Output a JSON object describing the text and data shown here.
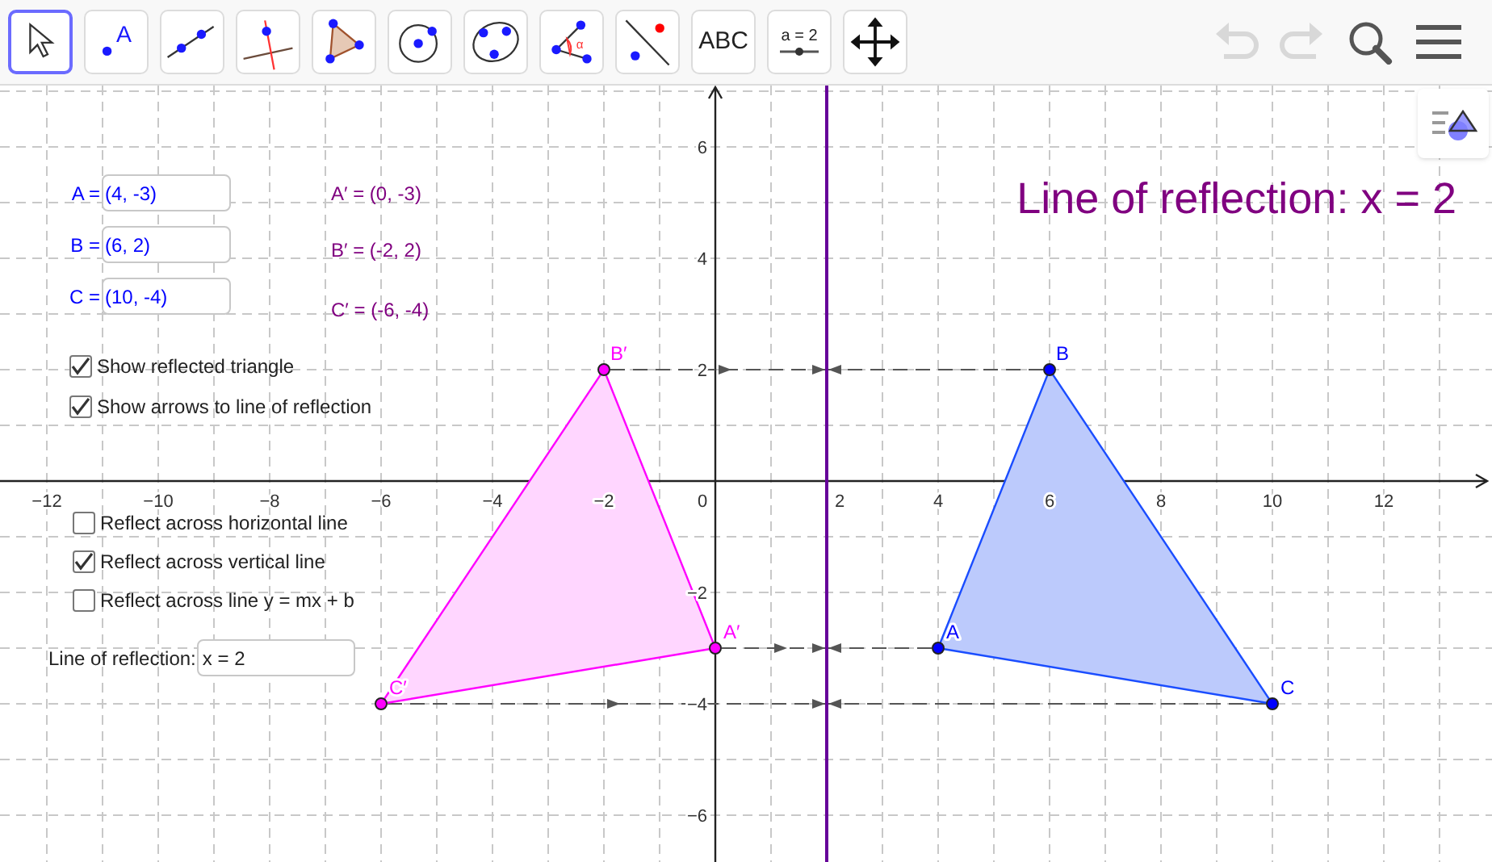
{
  "toolbar": {
    "tools": [
      {
        "kind": "move",
        "selected": true
      },
      {
        "kind": "point",
        "label": "A",
        "selected": false
      },
      {
        "kind": "line",
        "selected": false
      },
      {
        "kind": "perpendicular",
        "selected": false
      },
      {
        "kind": "polygon",
        "selected": false
      },
      {
        "kind": "circle",
        "selected": false
      },
      {
        "kind": "conic",
        "selected": false
      },
      {
        "kind": "angle",
        "label": "α",
        "selected": false
      },
      {
        "kind": "reflect",
        "selected": false
      },
      {
        "kind": "text",
        "label": "ABC",
        "selected": false
      },
      {
        "kind": "slider",
        "label": "a = 2",
        "selected": false
      },
      {
        "kind": "move-view",
        "selected": false
      }
    ],
    "actions": [
      {
        "kind": "undo",
        "disabled": true
      },
      {
        "kind": "redo",
        "disabled": true
      },
      {
        "kind": "search",
        "disabled": false
      },
      {
        "kind": "menu",
        "disabled": false
      }
    ]
  },
  "graphics": {
    "title": "Line of reflection: x = 2",
    "inputs": [
      {
        "label": "A =",
        "value": "(4, -3)",
        "image_text": "A′ = (0, -3)"
      },
      {
        "label": "B =",
        "value": "(6, 2)",
        "image_text": "B′ = (-2, 2)"
      },
      {
        "label": "C =",
        "value": "(10, -4)",
        "image_text": "C′ = (-6, -4)"
      }
    ],
    "show_options": [
      {
        "label": "Show reflected triangle",
        "checked": true
      },
      {
        "label": "Show arrows to line of reflection",
        "checked": true
      }
    ],
    "reflect_options": [
      {
        "label": "Reflect across horizontal line",
        "checked": false
      },
      {
        "label": "Reflect across vertical line",
        "checked": true
      },
      {
        "label": "Reflect across line y = mx + b",
        "checked": false
      }
    ],
    "line_field": {
      "label": "Line of reflection:",
      "value": "x = 2"
    },
    "x_axis_labels": [
      "−12",
      "−10",
      "−8",
      "−6",
      "−4",
      "−2",
      "0",
      "2",
      "4",
      "6",
      "8",
      "10",
      "12"
    ],
    "y_axis_labels": [
      "6",
      "4",
      "2",
      "−2",
      "−4",
      "−6"
    ],
    "points": [
      {
        "label": "A"
      },
      {
        "label": "B"
      },
      {
        "label": "C"
      }
    ],
    "image_points": [
      {
        "label": "A′"
      },
      {
        "label": "B′"
      },
      {
        "label": "C′"
      }
    ]
  }
}
